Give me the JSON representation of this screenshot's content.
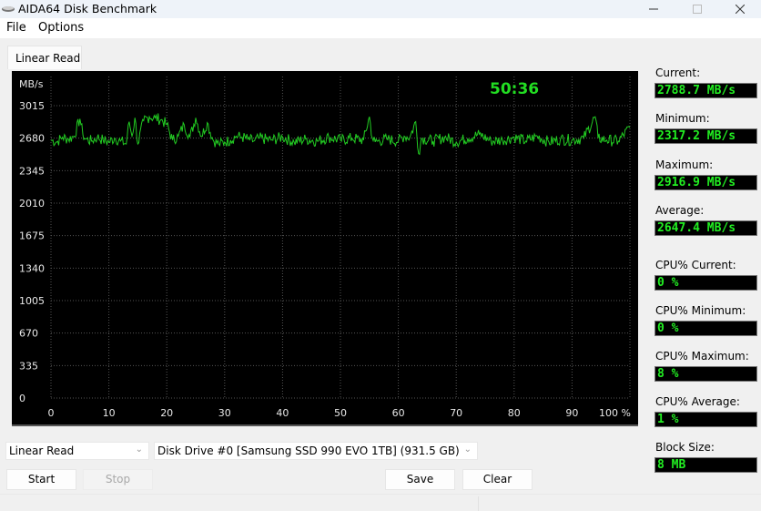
{
  "window": {
    "title": "AIDA64 Disk Benchmark",
    "icons": {
      "app": "disk-drive-icon",
      "minimize": "minimize-icon",
      "maximize": "maximize-icon",
      "close": "close-icon"
    }
  },
  "menu": [
    {
      "label": "File"
    },
    {
      "label": "Options"
    }
  ],
  "tabs": [
    {
      "label": "Linear Read",
      "active": true
    }
  ],
  "timer": "50:36",
  "stats": {
    "current": {
      "label": "Current:",
      "value": "2788.7 MB/s"
    },
    "minimum": {
      "label": "Minimum:",
      "value": "2317.2 MB/s"
    },
    "maximum": {
      "label": "Maximum:",
      "value": "2916.9 MB/s"
    },
    "average": {
      "label": "Average:",
      "value": "2647.4 MB/s"
    },
    "cpu_current": {
      "label": "CPU% Current:",
      "value": "0 %"
    },
    "cpu_minimum": {
      "label": "CPU% Minimum:",
      "value": "0 %"
    },
    "cpu_maximum": {
      "label": "CPU% Maximum:",
      "value": "8 %"
    },
    "cpu_average": {
      "label": "CPU% Average:",
      "value": "1 %"
    },
    "block_size": {
      "label": "Block Size:",
      "value": "8 MB"
    }
  },
  "controls": {
    "test_select": {
      "value": "Linear Read"
    },
    "drive_select": {
      "value": "Disk Drive #0  [Samsung SSD 990 EVO 1TB]  (931.5 GB)"
    },
    "start_label": "Start",
    "stop_label": "Stop",
    "save_label": "Save",
    "clear_label": "Clear"
  },
  "colors": {
    "line": "#22cc22",
    "value_text": "#22ee22",
    "grid": "#555555",
    "background": "#000000"
  },
  "chart_data": {
    "type": "line",
    "title": "",
    "xlabel": "%",
    "ylabel": "MB/s",
    "xlim": [
      0,
      100
    ],
    "ylim": [
      0,
      3015
    ],
    "grid": true,
    "x_ticks": [
      "0",
      "10",
      "20",
      "30",
      "40",
      "50",
      "60",
      "70",
      "80",
      "90",
      "100 %"
    ],
    "y_ticks": [
      "0",
      "335",
      "670",
      "1005",
      "1340",
      "1675",
      "2010",
      "2345",
      "2680",
      "3015"
    ],
    "y_unit_label": "MB/s",
    "series": [
      {
        "name": "Linear Read",
        "baseline": 2647,
        "noise": 60,
        "points": [
          [
            0,
            2660
          ],
          [
            1,
            2640
          ],
          [
            2,
            2690
          ],
          [
            3,
            2670
          ],
          [
            4,
            2700
          ],
          [
            5,
            2880
          ],
          [
            5.5,
            2720
          ],
          [
            6,
            2670
          ],
          [
            7,
            2650
          ],
          [
            8,
            2690
          ],
          [
            9,
            2660
          ],
          [
            10,
            2640
          ],
          [
            11,
            2680
          ],
          [
            12,
            2650
          ],
          [
            13,
            2620
          ],
          [
            13.5,
            2850
          ],
          [
            14,
            2700
          ],
          [
            14.5,
            2890
          ],
          [
            15,
            2620
          ],
          [
            16,
            2860
          ],
          [
            17,
            2900
          ],
          [
            18,
            2890
          ],
          [
            19,
            2870
          ],
          [
            20,
            2820
          ],
          [
            21,
            2660
          ],
          [
            22,
            2700
          ],
          [
            23,
            2820
          ],
          [
            24,
            2690
          ],
          [
            25,
            2890
          ],
          [
            26,
            2700
          ],
          [
            27,
            2840
          ],
          [
            28,
            2660
          ],
          [
            29,
            2620
          ],
          [
            30,
            2640
          ],
          [
            31,
            2660
          ],
          [
            32,
            2700
          ],
          [
            33,
            2690
          ],
          [
            34,
            2670
          ],
          [
            35,
            2650
          ],
          [
            36,
            2680
          ],
          [
            38,
            2660
          ],
          [
            40,
            2690
          ],
          [
            42,
            2640
          ],
          [
            44,
            2670
          ],
          [
            46,
            2650
          ],
          [
            48,
            2690
          ],
          [
            50,
            2660
          ],
          [
            52,
            2680
          ],
          [
            54,
            2660
          ],
          [
            55,
            2900
          ],
          [
            55.5,
            2680
          ],
          [
            56,
            2640
          ],
          [
            58,
            2670
          ],
          [
            60,
            2650
          ],
          [
            61,
            2700
          ],
          [
            62,
            2690
          ],
          [
            63,
            2850
          ],
          [
            63.5,
            2520
          ],
          [
            64,
            2680
          ],
          [
            66,
            2650
          ],
          [
            68,
            2690
          ],
          [
            70,
            2640
          ],
          [
            72,
            2680
          ],
          [
            74,
            2720
          ],
          [
            76,
            2650
          ],
          [
            78,
            2660
          ],
          [
            80,
            2690
          ],
          [
            82,
            2650
          ],
          [
            84,
            2700
          ],
          [
            86,
            2640
          ],
          [
            88,
            2670
          ],
          [
            90,
            2660
          ],
          [
            92,
            2680
          ],
          [
            94,
            2900
          ],
          [
            94.5,
            2680
          ],
          [
            96,
            2660
          ],
          [
            98,
            2650
          ],
          [
            100,
            2790
          ]
        ]
      }
    ]
  }
}
